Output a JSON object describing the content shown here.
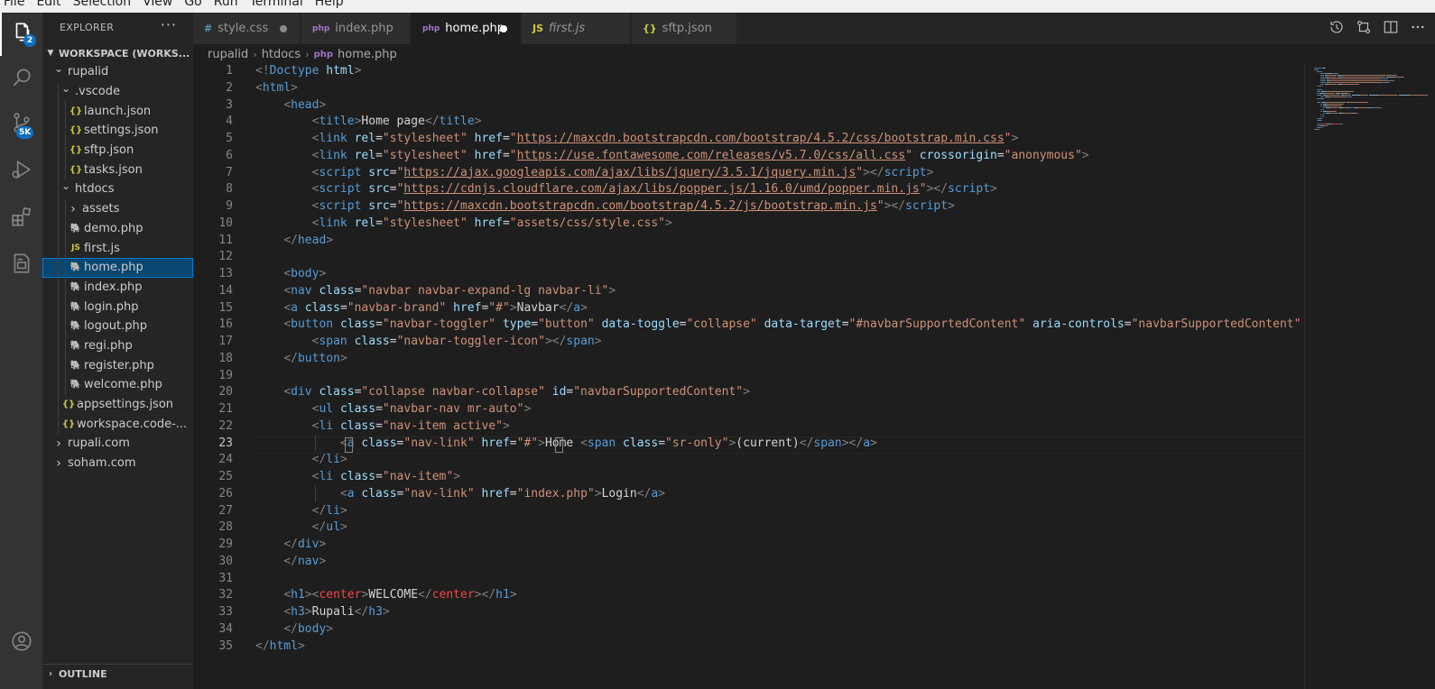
{
  "menubar": {
    "items": [
      "File",
      "Edit",
      "Selection",
      "View",
      "Go",
      "Run",
      "Terminal",
      "Help"
    ]
  },
  "activity_bar": {
    "items": [
      {
        "icon": "explorer-icon",
        "badge": "2"
      },
      {
        "icon": "search-icon"
      },
      {
        "icon": "source-control-icon",
        "badge": "5K"
      },
      {
        "icon": "run-debug-icon"
      },
      {
        "icon": "extensions-icon"
      },
      {
        "icon": "remote-explorer-icon"
      }
    ],
    "bottom": [
      {
        "icon": "account-icon"
      }
    ]
  },
  "sidebar": {
    "title": "EXPLORER",
    "more": "···",
    "workspace": "WORKSPACE (WORKS...",
    "tree": [
      {
        "label": "rupalid",
        "type": "folder-open"
      },
      {
        "label": ".vscode",
        "type": "folder-open"
      },
      {
        "label": "launch.json",
        "type": "json"
      },
      {
        "label": "settings.json",
        "type": "json"
      },
      {
        "label": "sftp.json",
        "type": "json"
      },
      {
        "label": "tasks.json",
        "type": "json"
      },
      {
        "label": "htdocs",
        "type": "folder-open"
      },
      {
        "label": "assets",
        "type": "folder-closed"
      },
      {
        "label": "demo.php",
        "type": "php"
      },
      {
        "label": "first.js",
        "type": "js"
      },
      {
        "label": "home.php",
        "type": "php"
      },
      {
        "label": "index.php",
        "type": "php"
      },
      {
        "label": "login.php",
        "type": "php"
      },
      {
        "label": "logout.php",
        "type": "php"
      },
      {
        "label": "regi.php",
        "type": "php"
      },
      {
        "label": "register.php",
        "type": "php"
      },
      {
        "label": "welcome.php",
        "type": "php"
      },
      {
        "label": "appsettings.json",
        "type": "json"
      },
      {
        "label": "workspace.code-...",
        "type": "json"
      },
      {
        "label": "rupali.com",
        "type": "folder-closed"
      },
      {
        "label": "soham.com",
        "type": "folder-closed"
      }
    ],
    "outline": "OUTLINE"
  },
  "tabs": [
    {
      "label": "style.css",
      "icon": "#",
      "icon_color": "#519aba",
      "dirty": true
    },
    {
      "label": "index.php",
      "icon": "php",
      "icon_color": "#a074c4",
      "dirty": false
    },
    {
      "label": "home.php",
      "icon": "php",
      "icon_color": "#a074c4",
      "dirty": true,
      "active": true
    },
    {
      "label": "first.js",
      "icon": "JS",
      "icon_color": "#cbcb41",
      "dirty": false,
      "italic": true
    },
    {
      "label": "sftp.json",
      "icon": "{}",
      "icon_color": "#cbcb41",
      "dirty": false
    }
  ],
  "breadcrumbs": [
    "rupalid",
    "htdocs",
    "home.php"
  ],
  "editor": {
    "current_line": 23,
    "lines": [
      [
        [
          "b",
          "<!"
        ],
        [
          "n",
          "Doctype"
        ],
        [
          "x",
          " "
        ],
        [
          "a",
          "html"
        ],
        [
          "b",
          ">"
        ]
      ],
      [
        [
          "b",
          "<"
        ],
        [
          "n",
          "html"
        ],
        [
          "b",
          ">"
        ]
      ],
      [
        [
          "x",
          "    "
        ],
        [
          "b",
          "<"
        ],
        [
          "n",
          "head"
        ],
        [
          "b",
          ">"
        ]
      ],
      [
        [
          "x",
          "        "
        ],
        [
          "b",
          "<"
        ],
        [
          "n",
          "title"
        ],
        [
          "b",
          ">"
        ],
        [
          "x",
          "Home page"
        ],
        [
          "b",
          "</"
        ],
        [
          "n",
          "title"
        ],
        [
          "b",
          ">"
        ]
      ],
      [
        [
          "x",
          "        "
        ],
        [
          "b",
          "<"
        ],
        [
          "n",
          "link"
        ],
        [
          "x",
          " "
        ],
        [
          "a",
          "rel"
        ],
        [
          "x",
          "="
        ],
        [
          "s",
          "\"stylesheet\""
        ],
        [
          "x",
          " "
        ],
        [
          "a",
          "href"
        ],
        [
          "x",
          "="
        ],
        [
          "s",
          "\""
        ],
        [
          "u",
          "https://maxcdn.bootstrapcdn.com/bootstrap/4.5.2/css/bootstrap.min.css"
        ],
        [
          "s",
          "\""
        ],
        [
          "b",
          ">"
        ]
      ],
      [
        [
          "x",
          "        "
        ],
        [
          "b",
          "<"
        ],
        [
          "n",
          "link"
        ],
        [
          "x",
          " "
        ],
        [
          "a",
          "rel"
        ],
        [
          "x",
          "="
        ],
        [
          "s",
          "\"stylesheet\""
        ],
        [
          "x",
          " "
        ],
        [
          "a",
          "href"
        ],
        [
          "x",
          "="
        ],
        [
          "s",
          "\""
        ],
        [
          "u",
          "https://use.fontawesome.com/releases/v5.7.0/css/all.css"
        ],
        [
          "s",
          "\""
        ],
        [
          "x",
          " "
        ],
        [
          "a",
          "crossorigin"
        ],
        [
          "x",
          "="
        ],
        [
          "s",
          "\"anonymous\""
        ],
        [
          "b",
          ">"
        ]
      ],
      [
        [
          "x",
          "        "
        ],
        [
          "b",
          "<"
        ],
        [
          "n",
          "script"
        ],
        [
          "x",
          " "
        ],
        [
          "a",
          "src"
        ],
        [
          "x",
          "="
        ],
        [
          "s",
          "\""
        ],
        [
          "u",
          "https://ajax.googleapis.com/ajax/libs/jquery/3.5.1/jquery.min.js"
        ],
        [
          "s",
          "\""
        ],
        [
          "b",
          "></"
        ],
        [
          "n",
          "script"
        ],
        [
          "b",
          ">"
        ]
      ],
      [
        [
          "x",
          "        "
        ],
        [
          "b",
          "<"
        ],
        [
          "n",
          "script"
        ],
        [
          "x",
          " "
        ],
        [
          "a",
          "src"
        ],
        [
          "x",
          "="
        ],
        [
          "s",
          "\""
        ],
        [
          "u",
          "https://cdnjs.cloudflare.com/ajax/libs/popper.js/1.16.0/umd/popper.min.js"
        ],
        [
          "s",
          "\""
        ],
        [
          "b",
          "></"
        ],
        [
          "n",
          "script"
        ],
        [
          "b",
          ">"
        ]
      ],
      [
        [
          "x",
          "        "
        ],
        [
          "b",
          "<"
        ],
        [
          "n",
          "script"
        ],
        [
          "x",
          " "
        ],
        [
          "a",
          "src"
        ],
        [
          "x",
          "="
        ],
        [
          "s",
          "\""
        ],
        [
          "u",
          "https://maxcdn.bootstrapcdn.com/bootstrap/4.5.2/js/bootstrap.min.js"
        ],
        [
          "s",
          "\""
        ],
        [
          "b",
          "></"
        ],
        [
          "n",
          "script"
        ],
        [
          "b",
          ">"
        ]
      ],
      [
        [
          "x",
          "        "
        ],
        [
          "b",
          "<"
        ],
        [
          "n",
          "link"
        ],
        [
          "x",
          " "
        ],
        [
          "a",
          "rel"
        ],
        [
          "x",
          "="
        ],
        [
          "s",
          "\"stylesheet\""
        ],
        [
          "x",
          " "
        ],
        [
          "a",
          "href"
        ],
        [
          "x",
          "="
        ],
        [
          "s",
          "\"assets/css/style.css\""
        ],
        [
          "b",
          ">"
        ]
      ],
      [
        [
          "x",
          "    "
        ],
        [
          "b",
          "</"
        ],
        [
          "n",
          "head"
        ],
        [
          "b",
          ">"
        ]
      ],
      [],
      [
        [
          "x",
          "    "
        ],
        [
          "b",
          "<"
        ],
        [
          "n",
          "body"
        ],
        [
          "b",
          ">"
        ]
      ],
      [
        [
          "x",
          "    "
        ],
        [
          "b",
          "<"
        ],
        [
          "n",
          "nav"
        ],
        [
          "x",
          " "
        ],
        [
          "a",
          "class"
        ],
        [
          "x",
          "="
        ],
        [
          "s",
          "\"navbar navbar-expand-lg navbar-li\""
        ],
        [
          "b",
          ">"
        ]
      ],
      [
        [
          "x",
          "    "
        ],
        [
          "b",
          "<"
        ],
        [
          "n",
          "a"
        ],
        [
          "x",
          " "
        ],
        [
          "a",
          "class"
        ],
        [
          "x",
          "="
        ],
        [
          "s",
          "\"navbar-brand\""
        ],
        [
          "x",
          " "
        ],
        [
          "a",
          "href"
        ],
        [
          "x",
          "="
        ],
        [
          "s",
          "\"#\""
        ],
        [
          "b",
          ">"
        ],
        [
          "x",
          "Navbar"
        ],
        [
          "b",
          "</"
        ],
        [
          "n",
          "a"
        ],
        [
          "b",
          ">"
        ]
      ],
      [
        [
          "x",
          "    "
        ],
        [
          "b",
          "<"
        ],
        [
          "n",
          "button"
        ],
        [
          "x",
          " "
        ],
        [
          "a",
          "class"
        ],
        [
          "x",
          "="
        ],
        [
          "s",
          "\"navbar-toggler\""
        ],
        [
          "x",
          " "
        ],
        [
          "a",
          "type"
        ],
        [
          "x",
          "="
        ],
        [
          "s",
          "\"button\""
        ],
        [
          "x",
          " "
        ],
        [
          "a",
          "data-toggle"
        ],
        [
          "x",
          "="
        ],
        [
          "s",
          "\"collapse\""
        ],
        [
          "x",
          " "
        ],
        [
          "a",
          "data-target"
        ],
        [
          "x",
          "="
        ],
        [
          "s",
          "\"#navbarSupportedContent\""
        ],
        [
          "x",
          " "
        ],
        [
          "a",
          "aria-controls"
        ],
        [
          "x",
          "="
        ],
        [
          "s",
          "\"navbarSupportedContent\""
        ]
      ],
      [
        [
          "x",
          "        "
        ],
        [
          "b",
          "<"
        ],
        [
          "n",
          "span"
        ],
        [
          "x",
          " "
        ],
        [
          "a",
          "class"
        ],
        [
          "x",
          "="
        ],
        [
          "s",
          "\"navbar-toggler-icon\""
        ],
        [
          "b",
          "></"
        ],
        [
          "n",
          "span"
        ],
        [
          "b",
          ">"
        ]
      ],
      [
        [
          "x",
          "    "
        ],
        [
          "b",
          "</"
        ],
        [
          "n",
          "button"
        ],
        [
          "b",
          ">"
        ]
      ],
      [],
      [
        [
          "x",
          "    "
        ],
        [
          "b",
          "<"
        ],
        [
          "n",
          "div"
        ],
        [
          "x",
          " "
        ],
        [
          "a",
          "class"
        ],
        [
          "x",
          "="
        ],
        [
          "s",
          "\"collapse navbar-collapse\""
        ],
        [
          "x",
          " "
        ],
        [
          "a",
          "id"
        ],
        [
          "x",
          "="
        ],
        [
          "s",
          "\"navbarSupportedContent\""
        ],
        [
          "b",
          ">"
        ]
      ],
      [
        [
          "x",
          "        "
        ],
        [
          "b",
          "<"
        ],
        [
          "n",
          "ul"
        ],
        [
          "x",
          " "
        ],
        [
          "a",
          "class"
        ],
        [
          "x",
          "="
        ],
        [
          "s",
          "\"navbar-nav mr-auto\""
        ],
        [
          "b",
          ">"
        ]
      ],
      [
        [
          "x",
          "        "
        ],
        [
          "b",
          "<"
        ],
        [
          "n",
          "li"
        ],
        [
          "x",
          " "
        ],
        [
          "a",
          "class"
        ],
        [
          "x",
          "="
        ],
        [
          "s",
          "\"nav-item active\""
        ],
        [
          "b",
          ">"
        ]
      ],
      [
        [
          "x",
          "            "
        ],
        [
          "b",
          "<"
        ],
        [
          "n",
          "a"
        ],
        [
          "x",
          " "
        ],
        [
          "a",
          "class"
        ],
        [
          "x",
          "="
        ],
        [
          "s",
          "\"nav-link\""
        ],
        [
          "x",
          " "
        ],
        [
          "a",
          "href"
        ],
        [
          "x",
          "="
        ],
        [
          "s",
          "\"#\""
        ],
        [
          "b",
          ">"
        ],
        [
          "x",
          "Home "
        ],
        [
          "b",
          "<"
        ],
        [
          "n",
          "span"
        ],
        [
          "x",
          " "
        ],
        [
          "a",
          "class"
        ],
        [
          "x",
          "="
        ],
        [
          "s",
          "\"sr-only\""
        ],
        [
          "b",
          ">"
        ],
        [
          "x",
          "(current)"
        ],
        [
          "b",
          "</"
        ],
        [
          "n",
          "span"
        ],
        [
          "b",
          "></"
        ],
        [
          "n",
          "a"
        ],
        [
          "b",
          ">"
        ]
      ],
      [
        [
          "x",
          "        "
        ],
        [
          "b",
          "</"
        ],
        [
          "n",
          "li"
        ],
        [
          "b",
          ">"
        ]
      ],
      [
        [
          "x",
          "        "
        ],
        [
          "b",
          "<"
        ],
        [
          "n",
          "li"
        ],
        [
          "x",
          " "
        ],
        [
          "a",
          "class"
        ],
        [
          "x",
          "="
        ],
        [
          "s",
          "\"nav-item\""
        ],
        [
          "b",
          ">"
        ]
      ],
      [
        [
          "x",
          "            "
        ],
        [
          "b",
          "<"
        ],
        [
          "n",
          "a"
        ],
        [
          "x",
          " "
        ],
        [
          "a",
          "class"
        ],
        [
          "x",
          "="
        ],
        [
          "s",
          "\"nav-link\""
        ],
        [
          "x",
          " "
        ],
        [
          "a",
          "href"
        ],
        [
          "x",
          "="
        ],
        [
          "s",
          "\"index.php\""
        ],
        [
          "b",
          ">"
        ],
        [
          "x",
          "Login"
        ],
        [
          "b",
          "</"
        ],
        [
          "n",
          "a"
        ],
        [
          "b",
          ">"
        ]
      ],
      [
        [
          "x",
          "        "
        ],
        [
          "b",
          "</"
        ],
        [
          "n",
          "li"
        ],
        [
          "b",
          ">"
        ]
      ],
      [
        [
          "x",
          "        "
        ],
        [
          "b",
          "</"
        ],
        [
          "n",
          "ul"
        ],
        [
          "b",
          ">"
        ]
      ],
      [
        [
          "x",
          "    "
        ],
        [
          "b",
          "</"
        ],
        [
          "n",
          "div"
        ],
        [
          "b",
          ">"
        ]
      ],
      [
        [
          "x",
          "    "
        ],
        [
          "b",
          "</"
        ],
        [
          "n",
          "nav"
        ],
        [
          "b",
          ">"
        ]
      ],
      [],
      [
        [
          "x",
          "    "
        ],
        [
          "b",
          "<"
        ],
        [
          "n",
          "h1"
        ],
        [
          "b",
          "><"
        ],
        [
          "c",
          "center"
        ],
        [
          "b",
          ">"
        ],
        [
          "x",
          "WELCOME"
        ],
        [
          "b",
          "</"
        ],
        [
          "c",
          "center"
        ],
        [
          "b",
          "></"
        ],
        [
          "n",
          "h1"
        ],
        [
          "b",
          ">"
        ]
      ],
      [
        [
          "x",
          "    "
        ],
        [
          "b",
          "<"
        ],
        [
          "n",
          "h3"
        ],
        [
          "b",
          ">"
        ],
        [
          "x",
          "Rupali"
        ],
        [
          "b",
          "</"
        ],
        [
          "n",
          "h3"
        ],
        [
          "b",
          ">"
        ]
      ],
      [
        [
          "x",
          "    "
        ],
        [
          "b",
          "</"
        ],
        [
          "n",
          "body"
        ],
        [
          "b",
          ">"
        ]
      ],
      [
        [
          "b",
          "</"
        ],
        [
          "n",
          "html"
        ],
        [
          "b",
          ">"
        ]
      ]
    ]
  },
  "colors": {
    "activity_bg": "#333333",
    "sidebar_bg": "#252526",
    "editor_bg": "#1e1e1e",
    "selection": "#094771",
    "badge": "#0e70c0",
    "dirty_dot": "#ffffff"
  }
}
